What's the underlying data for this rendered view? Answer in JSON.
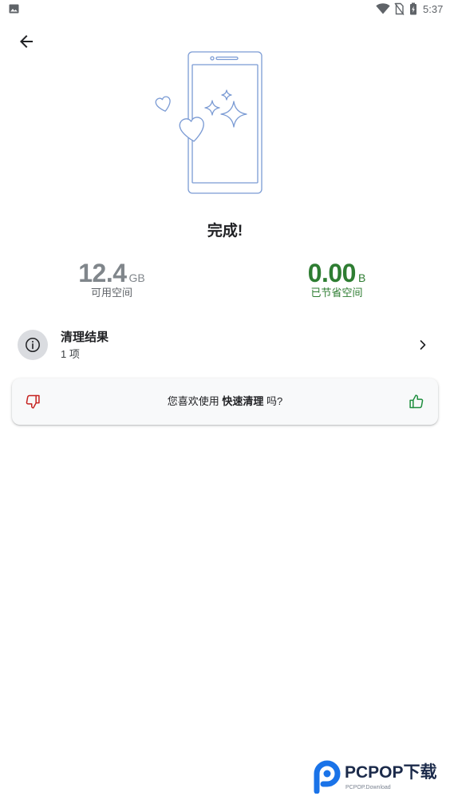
{
  "status_bar": {
    "time": "5:37",
    "left_icon": "image-icon",
    "right_icons": [
      "wifi-icon",
      "no-sim-icon",
      "battery-icon"
    ]
  },
  "header": {
    "back_icon": "arrow-left-icon"
  },
  "result": {
    "title": "完成!"
  },
  "stats": {
    "available": {
      "value": "12.4",
      "unit": "GB",
      "label": "可用空间",
      "color": "#80868b"
    },
    "saved": {
      "value": "0.00",
      "unit": "B",
      "label": "已节省空间",
      "color": "#2e7d32"
    }
  },
  "cleanup_result": {
    "icon": "info-icon",
    "title": "清理结果",
    "subtitle": "1 项",
    "trailing_icon": "chevron-right-icon"
  },
  "feedback": {
    "prefix": "您喜欢使用 ",
    "feature": "快速清理",
    "suffix": " 吗?",
    "dislike_icon": "thumbs-down-icon",
    "like_icon": "thumbs-up-icon",
    "dislike_color": "#c5221f",
    "like_color": "#1e8e3e"
  },
  "watermark": {
    "brand": "PCPOP下载",
    "tagline": "PCPOP.Download"
  },
  "colors": {
    "background": "#ffffff",
    "text": "#202124",
    "illustration_stroke": "#7b9bd4"
  }
}
